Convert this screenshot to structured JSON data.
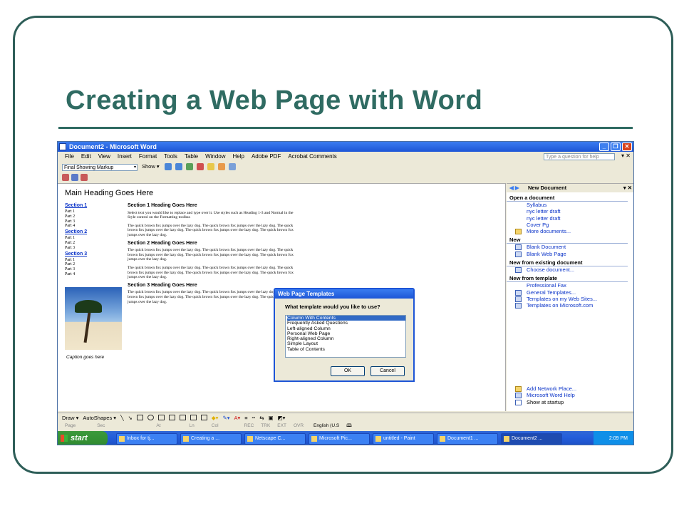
{
  "slide": {
    "title": "Creating a Web Page with Word"
  },
  "window": {
    "title": "Document2 - Microsoft Word",
    "menu": [
      "File",
      "Edit",
      "View",
      "Insert",
      "Format",
      "Tools",
      "Table",
      "Window",
      "Help",
      "Adobe PDF",
      "Acrobat Comments"
    ],
    "ask_placeholder": "Type a question for help",
    "markup_select": "Final Showing Markup",
    "show_label": "Show ▾"
  },
  "document": {
    "main_heading": "Main Heading Goes Here",
    "toc": [
      {
        "section": "Section 1",
        "parts": [
          "Part 1",
          "Part 2",
          "Part 3",
          "Part 4"
        ]
      },
      {
        "section": "Section 2",
        "parts": [
          "Part 1",
          "Part 2",
          "Part 3"
        ]
      },
      {
        "section": "Section 3",
        "parts": [
          "Part 1",
          "Part 2",
          "Part 3",
          "Part 4"
        ]
      }
    ],
    "caption": "Caption goes here",
    "section1_heading": "Section 1 Heading Goes Here",
    "section1_intro": "Select text you would like to replace and type over it. Use styles such as Heading 1-3 and Normal in the Style control on the Formatting toolbar.",
    "section2_heading": "Section 2 Heading Goes Here",
    "section3_heading": "Section 3 Heading Goes Here",
    "filler": "The quick brown fox jumps over the lazy dog. The quick brown fox jumps over the lazy dog. The quick brown fox jumps over the lazy dog. The quick brown fox jumps over the lazy dog. The quick brown fox jumps over the lazy dog."
  },
  "dialog": {
    "title": "Web Page Templates",
    "question": "What template would you like to use?",
    "options": [
      "Column With Contents",
      "Frequently Asked Questions",
      "Left-aligned Column",
      "Personal Web Page",
      "Right-aligned Column",
      "Simple Layout",
      "Table of Contents"
    ],
    "ok": "OK",
    "cancel": "Cancel"
  },
  "taskpane": {
    "title": "New Document",
    "open_header": "Open a document",
    "recent": [
      "Syllabus",
      "nyc letter draft",
      "nyc letter draft",
      "Cover Pg"
    ],
    "more_docs": "More documents...",
    "new_header": "New",
    "blank_doc": "Blank Document",
    "blank_web": "Blank Web Page",
    "existing_header": "New from existing document",
    "choose_doc": "Choose document...",
    "template_header": "New from template",
    "prof_fax": "Professional Fax",
    "general_templates": "General Templates...",
    "web_sites": "Templates on my Web Sites...",
    "ms_com": "Templates on Microsoft.com",
    "add_network": "Add Network Place...",
    "word_help": "Microsoft Word Help",
    "show_startup": "Show at startup"
  },
  "drawbar": {
    "draw": "Draw ▾",
    "autoshapes": "AutoShapes ▾"
  },
  "statusbar": {
    "page": "Page",
    "sec": "Sec",
    "at": "At",
    "ln": "Ln",
    "col": "Col",
    "rec": "REC",
    "trk": "TRK",
    "ext": "EXT",
    "ovr": "OVR",
    "lang": "English (U.S"
  },
  "taskbar": {
    "start": "start",
    "tasks": [
      "Inbox for tj...",
      "Creating a ...",
      "Netscape C...",
      "Microsoft Pic...",
      "untitled - Paint",
      "Document1 ...",
      "Document2 ..."
    ],
    "time": "2:09 PM"
  }
}
